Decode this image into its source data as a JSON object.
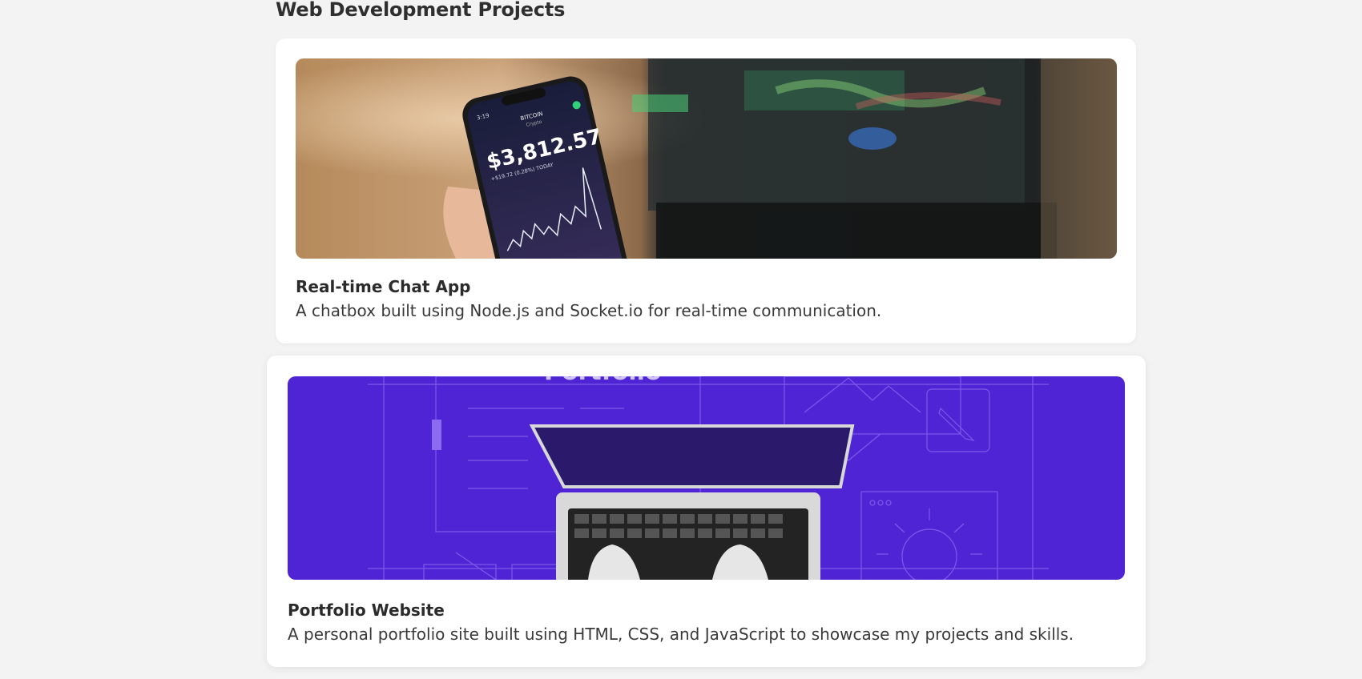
{
  "section": {
    "title": "Web Development Projects"
  },
  "projects": [
    {
      "title": "Real-time Chat App",
      "description": "A chatbox built using Node.js and Socket.io for real-time communication.",
      "image": {
        "icon": "phone-crypto-chart-photo",
        "phone_price": "$3,812.57",
        "phone_change": "+$19.72 (0.28%) TODAY",
        "phone_coin": "BITCOIN",
        "phone_coin_sub": "Crypto",
        "phone_time": "3:19",
        "phone_back": "Search"
      }
    },
    {
      "title": "Portfolio Website",
      "description": "A personal portfolio site built using HTML, CSS, and JavaScript to showcase my projects and skills.",
      "image": {
        "icon": "laptop-portfolio-illustration",
        "banner_text": "Portfolio",
        "background": "#4f24d4"
      }
    }
  ]
}
